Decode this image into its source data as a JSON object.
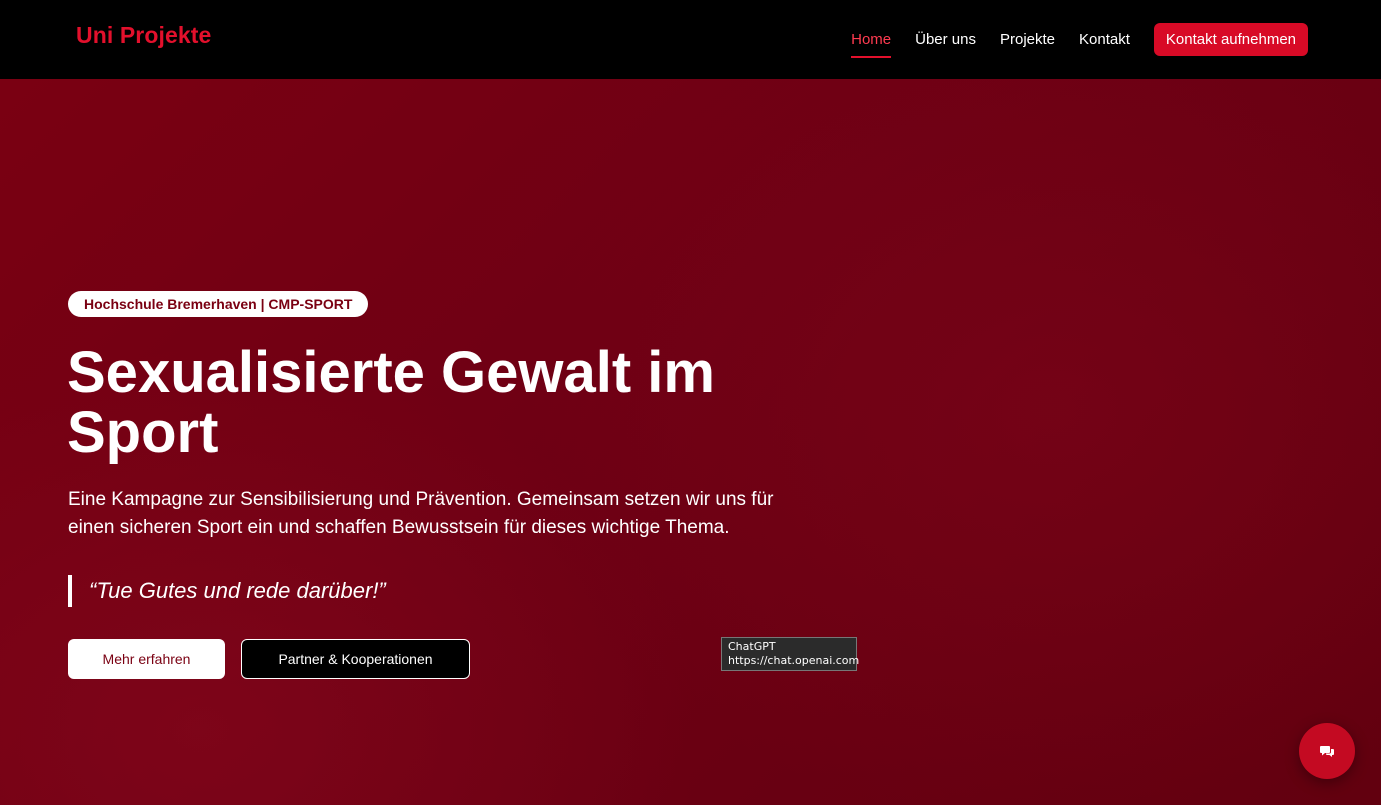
{
  "navbar": {
    "brand": "Uni Projekte",
    "links": [
      {
        "label": "Home",
        "active": true
      },
      {
        "label": "Über uns",
        "active": false
      },
      {
        "label": "Projekte",
        "active": false
      },
      {
        "label": "Kontakt",
        "active": false
      }
    ],
    "cta_label": "Kontakt aufnehmen"
  },
  "hero": {
    "badge": "Hochschule Bremerhaven | CMP-SPORT",
    "title": "Sexualisierte Gewalt im Sport",
    "text": "Eine Kampagne zur Sensibilisierung und Prävention. Gemeinsam setzen wir uns für einen sicheren Sport ein und schaffen Bewusstsein für dieses wichtige Thema.",
    "quote": "“Tue Gutes und rede darüber!”",
    "primary_button": "Mehr erfahren",
    "secondary_button": "Partner & Kooperationen"
  },
  "tooltip": {
    "title": "ChatGPT",
    "url": "https://chat.openai.com"
  },
  "chat": {
    "icon": "chat-bubbles-icon"
  },
  "colors": {
    "brand_red": "#e3102c",
    "cta_red": "#d80a26",
    "hero_dark_red": "#6e0014",
    "navbar_bg": "#000000"
  }
}
